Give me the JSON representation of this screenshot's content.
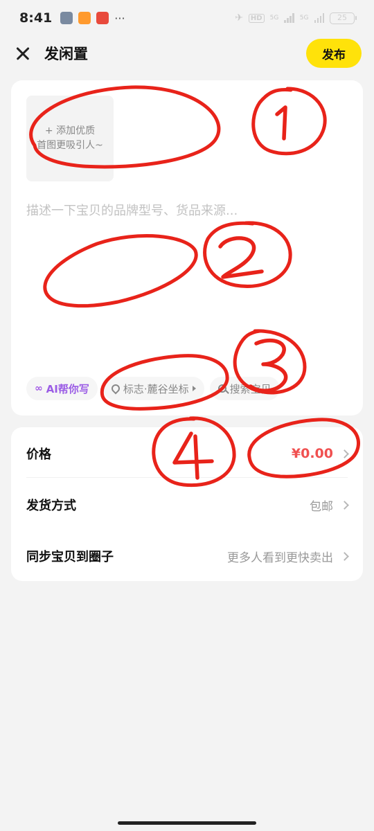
{
  "status_bar": {
    "time": "8:41",
    "hd": "HD",
    "net1": "5G",
    "net2": "5G",
    "battery": "25"
  },
  "header": {
    "title": "发闲置",
    "publish_label": "发布"
  },
  "photo": {
    "add_line1": "+ 添加优质",
    "add_line2": "首图更吸引人~"
  },
  "description": {
    "placeholder": "描述一下宝贝的品牌型号、货品来源..."
  },
  "chips": {
    "ai": "AI帮你写",
    "location": "标志·麓谷坐标",
    "search": "搜索宝贝"
  },
  "rows": {
    "price": {
      "label": "价格",
      "value": "¥0.00"
    },
    "shipping": {
      "label": "发货方式",
      "value": "包邮"
    },
    "sync": {
      "label": "同步宝贝到圈子",
      "value": "更多人看到更快卖出"
    }
  },
  "annotations": {
    "n1": "1",
    "n2": "2",
    "n3": "3",
    "n4": "4"
  },
  "colors": {
    "accent": "#ffe20a",
    "price": "#f05050",
    "annotation": "#e8231a"
  }
}
